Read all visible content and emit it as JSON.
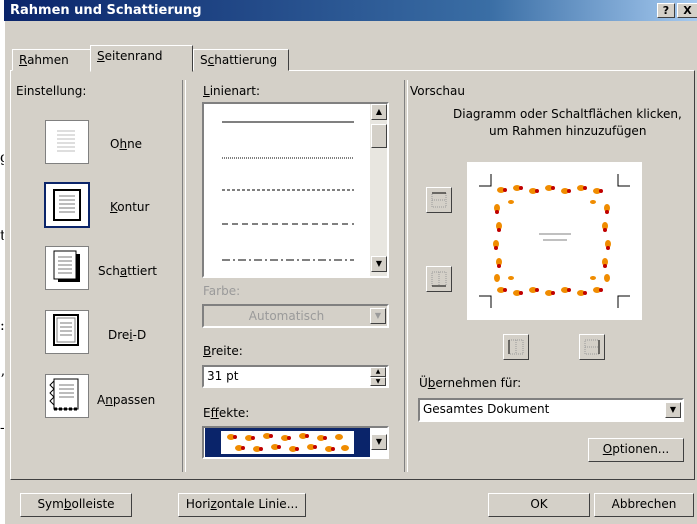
{
  "window": {
    "title": "Rahmen und Schattierung",
    "help": "?",
    "close": "X"
  },
  "background": {
    "chars": [
      "g",
      "t",
      ":",
      "ʼ",
      "-"
    ]
  },
  "tabs": [
    {
      "label_pre": "",
      "label_u": "R",
      "label_post": "ahmen"
    },
    {
      "label_pre": "",
      "label_u": "S",
      "label_post": "eitenrand"
    },
    {
      "label_pre": "S",
      "label_u": "c",
      "label_post": "hattierung"
    }
  ],
  "einstellung": {
    "title": "Einstellung:",
    "items": [
      {
        "pre": "O",
        "u": "h",
        "post": "ne"
      },
      {
        "pre": "",
        "u": "K",
        "post": "ontur"
      },
      {
        "pre": "Sch",
        "u": "a",
        "post": "ttiert"
      },
      {
        "pre": "Dre",
        "u": "i",
        "post": "-D"
      },
      {
        "pre": "A",
        "u": "n",
        "post": "passen"
      }
    ]
  },
  "linienart": {
    "pre": "",
    "u": "L",
    "post": "inienart:"
  },
  "farbe": {
    "label": "Farbe:",
    "value": "Automatisch"
  },
  "breite": {
    "pre": "",
    "u": "B",
    "post": "reite:",
    "value": "31 pt"
  },
  "effekte": {
    "pre": "E",
    "u": "f",
    "post": "fekte:"
  },
  "vorschau": {
    "title": "Vorschau",
    "hint_line1": "Diagramm oder Schaltflächen klicken,",
    "hint_line2": "um Rahmen hinzuzufügen"
  },
  "uebernehmen": {
    "pre": "Ü",
    "u": "b",
    "post": "ernehmen für:",
    "value": "Gesamtes Dokument"
  },
  "buttons": {
    "optionen": {
      "pre": "",
      "u": "O",
      "post": "ptionen..."
    },
    "symbolleiste": {
      "pre": "Sym",
      "u": "b",
      "post": "olleiste"
    },
    "horizontale": {
      "pre": "Hori",
      "u": "z",
      "post": "ontale Linie..."
    },
    "ok": "OK",
    "abbrechen": "Abbrechen"
  },
  "colors": {
    "titlebar": "#0a246a",
    "face": "#d4d0c8",
    "art_orange": "#f08c00",
    "art_red": "#c00000",
    "art_navy": "#0a246a"
  }
}
